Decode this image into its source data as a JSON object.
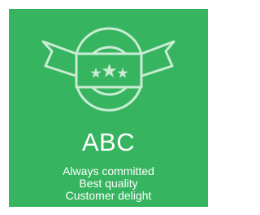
{
  "colors": {
    "background": "#37b460",
    "emblem_line": "#c9ecd3",
    "text": "#ffffff"
  },
  "emblem": {
    "icon": "badge-ribbon-three-stars-icon",
    "stars": 3
  },
  "tile": {
    "title": "ABC",
    "taglines": [
      "Always committed",
      "Best quality",
      "Customer delight"
    ]
  }
}
